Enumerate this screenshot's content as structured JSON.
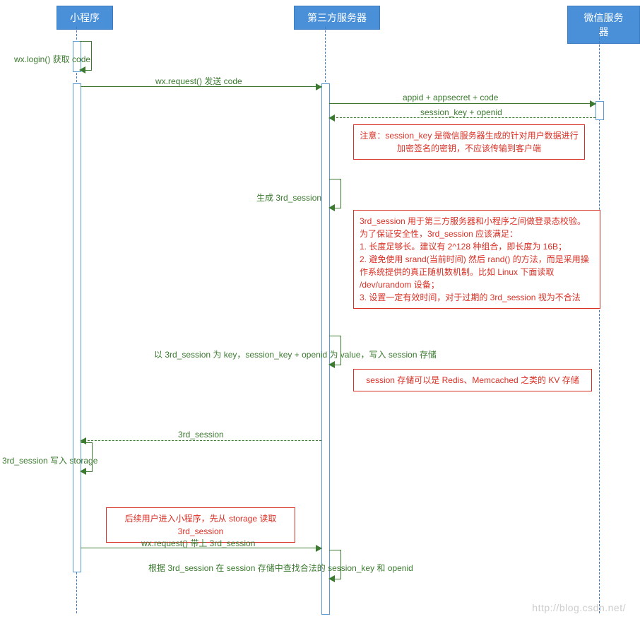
{
  "actors": {
    "a1": "小程序",
    "a2": "第三方服务器",
    "a3": "微信服务器"
  },
  "messages": {
    "m1": "wx.login() 获取 code",
    "m2": "wx.request() 发送 code",
    "m3": "appid + appsecret + code",
    "m4": "session_key + openid",
    "m5": "生成 3rd_session",
    "m6": "以 3rd_session 为 key，session_key + openid 为 value，写入 session 存储",
    "m7": "3rd_session",
    "m8": "3rd_session 写入 storage",
    "m9": "wx.request() 带上 3rd_session",
    "m10": "根据 3rd_session 在 session 存储中查找合法的 session_key 和 openid"
  },
  "notes": {
    "n1": "注意：session_key 是微信服务器生成的针对用户数据进行加密签名的密钥，不应该传输到客户端",
    "n2_l1": "3rd_session 用于第三方服务器和小程序之间做登录态校验。为了保证安全性，3rd_session 应该满足：",
    "n2_l2": "1. 长度足够长。建议有 2^128 种组合，即长度为 16B；",
    "n2_l3": "2. 避免使用 srand(当前时间) 然后 rand() 的方法，而是采用操作系统提供的真正随机数机制。比如 Linux 下面读取 /dev/urandom 设备；",
    "n2_l4": "3. 设置一定有效时间，对于过期的 3rd_session 视为不合法",
    "n3": "session 存储可以是 Redis、Memcached 之类的 KV 存储",
    "n4": "后续用户进入小程序，先从 storage 读取 3rd_session"
  },
  "watermark": "http://blog.csdn.net/"
}
